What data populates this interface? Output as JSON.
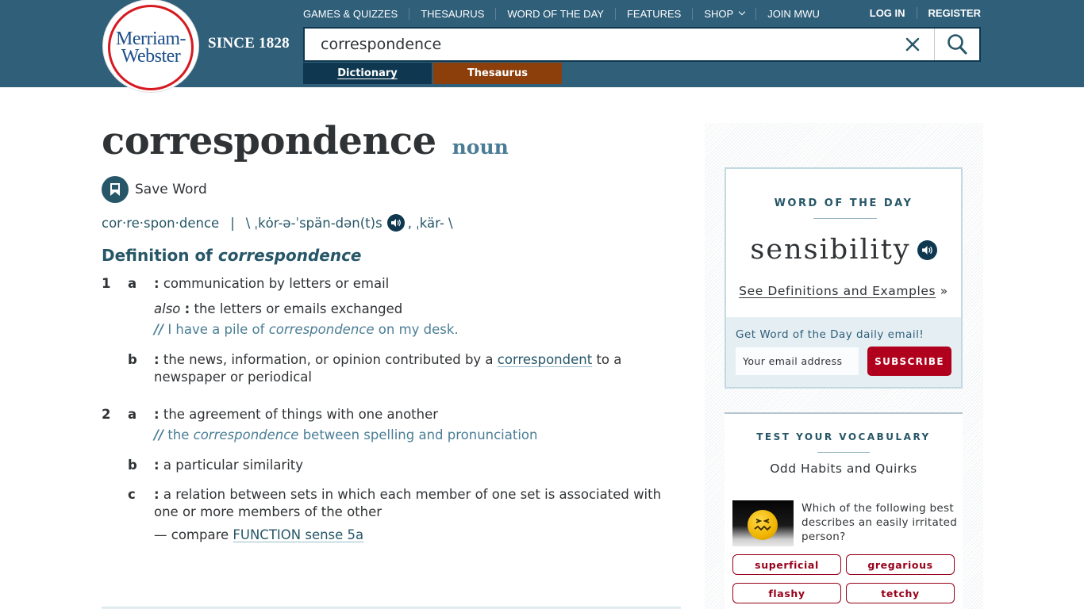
{
  "brand": {
    "logo_line1": "Merriam-",
    "logo_line2": "Webster",
    "tagline": "SINCE 1828",
    "colors": {
      "header_bg": "#305f7a",
      "logo_red": "#d71920",
      "logo_blue": "#1c4e8a"
    }
  },
  "topnav": {
    "items": [
      {
        "label": "GAMES & QUIZZES"
      },
      {
        "label": "THESAURUS"
      },
      {
        "label": "WORD OF THE DAY"
      },
      {
        "label": "FEATURES"
      },
      {
        "label": "SHOP",
        "icon": "chevron-down-icon"
      },
      {
        "label": "JOIN MWU"
      }
    ],
    "login": "LOG IN",
    "register": "REGISTER"
  },
  "search": {
    "value": "correspondence",
    "clear_icon": "close-icon",
    "submit_icon": "search-icon"
  },
  "mode_tabs": {
    "dictionary": "Dictionary",
    "thesaurus": "Thesaurus",
    "colors": {
      "dictionary": "#0f3850",
      "thesaurus": "#8c3e0b"
    }
  },
  "entry": {
    "headword": "correspondence",
    "part_of_speech": "noun",
    "save_word": "Save Word",
    "syllables": "cor·re·spon·dence",
    "pron_separator": "|",
    "pron_open": "\\ ˌkȯr-ə-ˈspän-dən(t)s",
    "pron_alt": ", ˌkär- \\",
    "definition_heading_prefix": "Definition of ",
    "definition_heading_word": "correspondence",
    "senses": [
      {
        "number": "1",
        "letter": "a",
        "colon": ":",
        "text": "communication by letters or email",
        "also_label": "also",
        "also_colon": ":",
        "also_text": "the letters or emails exchanged",
        "example_marker": "//",
        "example_pre": "I have a pile of ",
        "example_word": "correspondence",
        "example_post": " on my desk."
      },
      {
        "letter": "b",
        "colon": ":",
        "text_pre": "the news, information, or opinion contributed by a ",
        "link": "correspondent",
        "text_post": " to a newspaper or periodical"
      },
      {
        "number": "2",
        "letter": "a",
        "colon": ":",
        "text": "the agreement of things with one another",
        "example_marker": "//",
        "example_pre": "the ",
        "example_word": "correspondence",
        "example_post": " between spelling and pronunciation"
      },
      {
        "letter": "b",
        "colon": ":",
        "text": "a particular similarity"
      },
      {
        "letter": "c",
        "colon": ":",
        "text": "a relation between sets in which each member of one set is associated with one or more members of the other",
        "compare_pre": "— compare ",
        "compare_link": "FUNCTION sense 5a"
      }
    ]
  },
  "sidebar": {
    "wotd": {
      "title": "WORD OF THE DAY",
      "word": "sensibility",
      "link": "See Definitions and Examples",
      "link_suffix": "»",
      "email_label": "Get Word of the Day daily email!",
      "email_placeholder": "Your email address",
      "subscribe": "SUBSCRIBE",
      "subscribe_color": "#b0001d"
    },
    "vocab": {
      "title": "TEST YOUR VOCABULARY",
      "subtitle": "Odd Habits and Quirks",
      "question": "Which of the following best describes an easily irritated person?",
      "options": [
        "superficial",
        "gregarious",
        "flashy",
        "tetchy"
      ],
      "option_color": "#97001a"
    }
  }
}
